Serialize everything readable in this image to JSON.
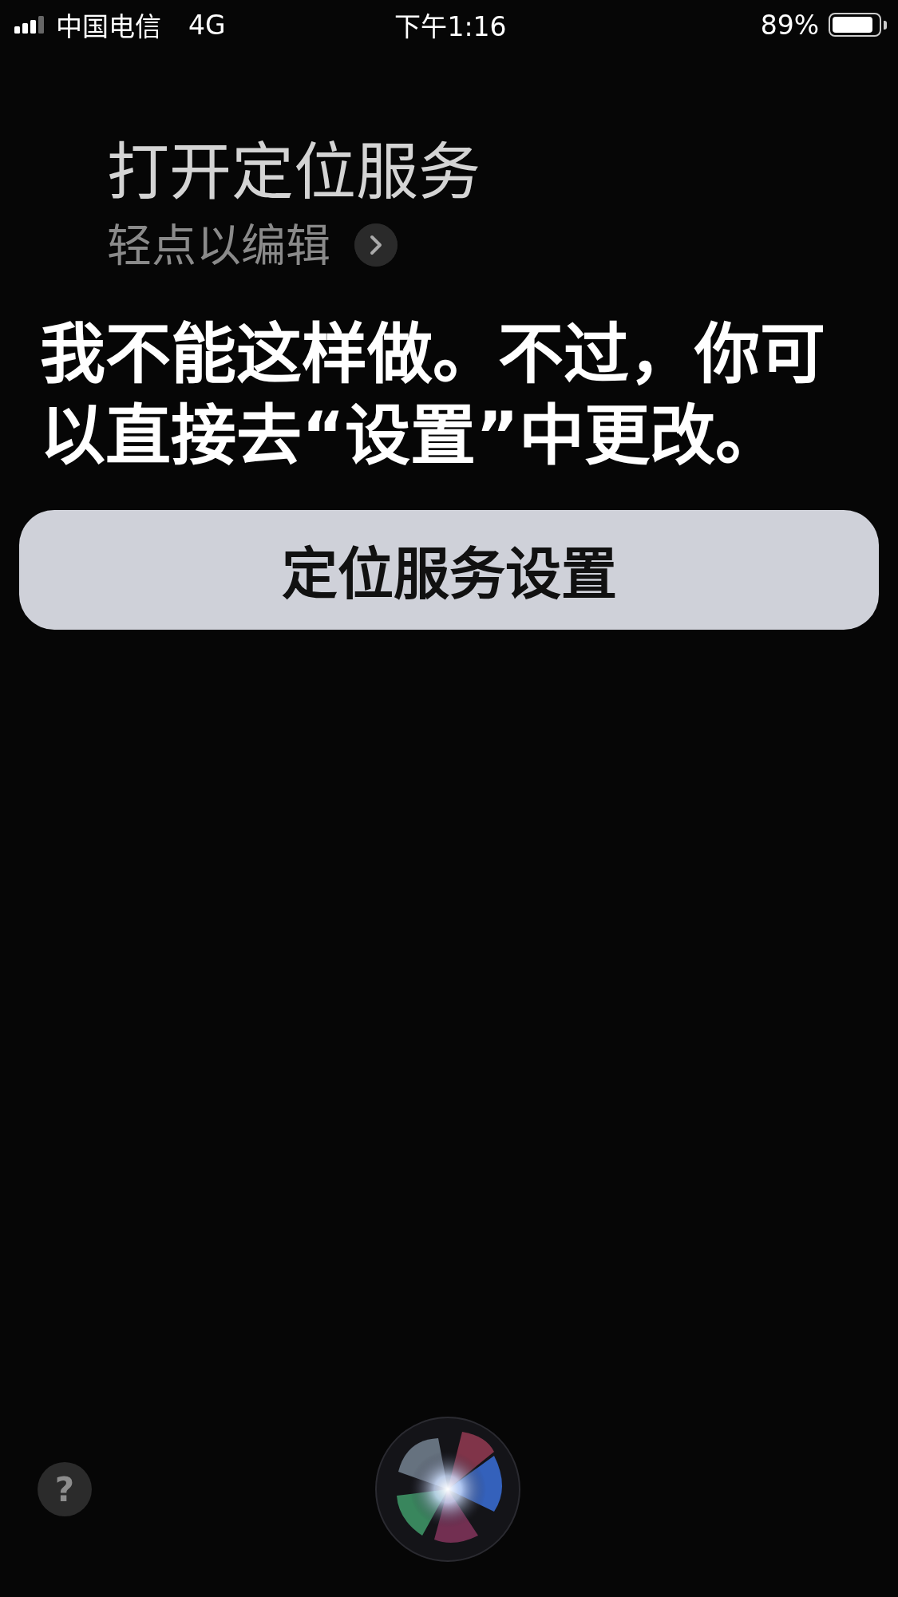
{
  "status_bar": {
    "carrier": "中国电信",
    "network": "4G",
    "time": "下午1:16",
    "battery_percent": "89%",
    "battery": {
      "level": 0.89
    }
  },
  "query": {
    "text": "打开定位服务",
    "edit_hint": "轻点以编辑"
  },
  "response": {
    "text": "我不能这样做。不过，你可以直接去“设置”中更改。"
  },
  "action_button": {
    "label": "定位服务设置"
  },
  "help_button": {
    "label": "?"
  }
}
